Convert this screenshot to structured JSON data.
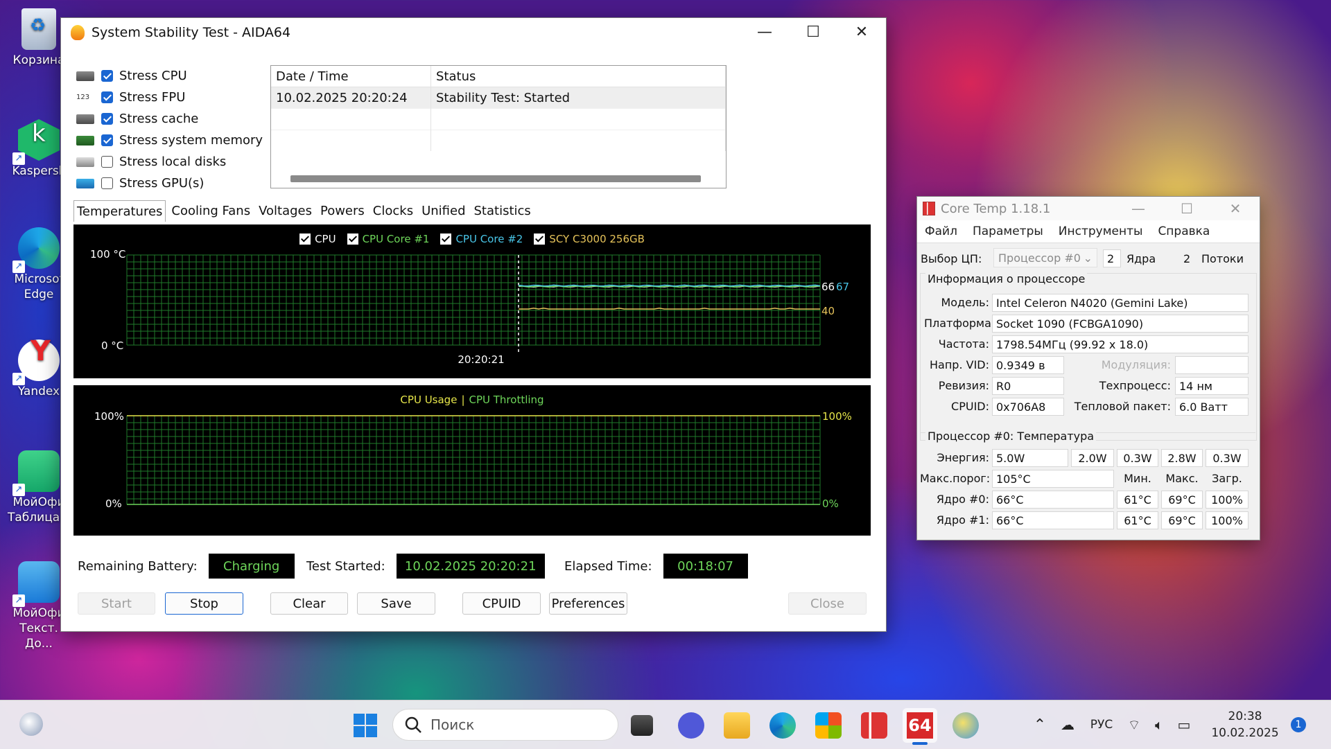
{
  "desktop": {
    "icons": [
      {
        "label": "Корзина"
      },
      {
        "label": "Kaspersk"
      },
      {
        "label": "Microsof Edge"
      },
      {
        "label": "Yandex"
      },
      {
        "label": "МойОфи Таблица..."
      },
      {
        "label": "МойОфи Текст. До..."
      }
    ]
  },
  "aida": {
    "title": "System Stability Test - AIDA64",
    "stress": [
      {
        "label": "Stress CPU",
        "checked": true
      },
      {
        "label": "Stress FPU",
        "checked": true
      },
      {
        "label": "Stress cache",
        "checked": true
      },
      {
        "label": "Stress system memory",
        "checked": true
      },
      {
        "label": "Stress local disks",
        "checked": false
      },
      {
        "label": "Stress GPU(s)",
        "checked": false
      }
    ],
    "log": {
      "headers": [
        "Date / Time",
        "Status"
      ],
      "rows": [
        [
          "10.02.2025 20:20:24",
          "Stability Test: Started"
        ]
      ]
    },
    "tabs": [
      "Temperatures",
      "Cooling Fans",
      "Voltages",
      "Powers",
      "Clocks",
      "Unified",
      "Statistics"
    ],
    "temp_legend": [
      "CPU",
      "CPU Core #1",
      "CPU Core #2",
      "SCY C3000 256GB"
    ],
    "usage_legend": [
      "CPU Usage",
      "|",
      "CPU Throttling"
    ],
    "status": {
      "battery_label": "Remaining Battery:",
      "battery_value": "Charging",
      "started_label": "Test Started:",
      "started_value": "10.02.2025 20:20:21",
      "elapsed_label": "Elapsed Time:",
      "elapsed_value": "00:18:07"
    },
    "buttons": {
      "start": "Start",
      "stop": "Stop",
      "clear": "Clear",
      "save": "Save",
      "cpuid": "CPUID",
      "preferences": "Preferences",
      "close": "Close"
    }
  },
  "chart_data": [
    {
      "type": "line",
      "ylim": [
        0,
        100
      ],
      "ytick_labels": [
        "100 °C",
        "0 °C"
      ],
      "x_label": "20:20:21",
      "start_fraction": 0.565,
      "series": [
        {
          "name": "CPU",
          "color": "#ffffff",
          "end_value": 66
        },
        {
          "name": "CPU Core #1",
          "color": "#6ed65a",
          "end_value": 66
        },
        {
          "name": "CPU Core #2",
          "color": "#49c6e8",
          "end_value": 67
        },
        {
          "name": "SCY C3000 256GB",
          "color": "#e6c35a",
          "end_value": 40
        }
      ],
      "value_labels": [
        "66",
        "67",
        "40"
      ]
    },
    {
      "type": "line",
      "ylim": [
        0,
        100
      ],
      "left_ticks": [
        "100%",
        "0%"
      ],
      "right_ticks": [
        "100%",
        "0%"
      ],
      "series": [
        {
          "name": "CPU Usage",
          "color": "#e6e64a"
        },
        {
          "name": "CPU Throttling",
          "color": "#6ed65a"
        }
      ]
    }
  ],
  "coretemp": {
    "title": "Core Temp 1.18.1",
    "menu": [
      "Файл",
      "Параметры",
      "Инструменты",
      "Справка"
    ],
    "cpu_select_label": "Выбор ЦП:",
    "cpu_select_value": "Процессор #0",
    "cores_count": "2",
    "cores_label": "Ядра",
    "threads_count": "2",
    "threads_label": "Потоки",
    "info_header": "Информация о процессоре",
    "model_label": "Модель:",
    "model": "Intel Celeron N4020 (Gemini Lake)",
    "platform_label": "Платформа:",
    "platform": "Socket 1090 (FCBGA1090)",
    "freq_label": "Частота:",
    "freq": "1798.54МГц (99.92 x 18.0)",
    "vid_label": "Напр. VID:",
    "vid": "0.9349 в",
    "mod_label": "Модуляция:",
    "rev_label": "Ревизия:",
    "rev": "R0",
    "lith_label": "Техпроцесс:",
    "lith": "14 нм",
    "cpuid_label": "CPUID:",
    "cpuid": "0x706A8",
    "tdp_label": "Тепловой пакет:",
    "tdp": "6.0 Ватт",
    "temp_header": "Процессор #0: Температура",
    "power_label": "Энергия:",
    "power": [
      "5.0W",
      "2.0W",
      "0.3W",
      "2.8W",
      "0.3W"
    ],
    "tjmax_label": "Макс.порог:",
    "tjmax": "105°C",
    "col_min": "Мин.",
    "col_max": "Макс.",
    "col_load": "Загр.",
    "cores": [
      {
        "label": "Ядро #0:",
        "temp": "66°C",
        "min": "61°C",
        "max": "69°C",
        "load": "100%"
      },
      {
        "label": "Ядро #1:",
        "temp": "66°C",
        "min": "61°C",
        "max": "69°C",
        "load": "100%"
      }
    ]
  },
  "taskbar": {
    "search_placeholder": "Поиск",
    "lang": "РУС",
    "time": "20:38",
    "date": "10.02.2025",
    "notifications": "1",
    "aida_label": "64"
  }
}
